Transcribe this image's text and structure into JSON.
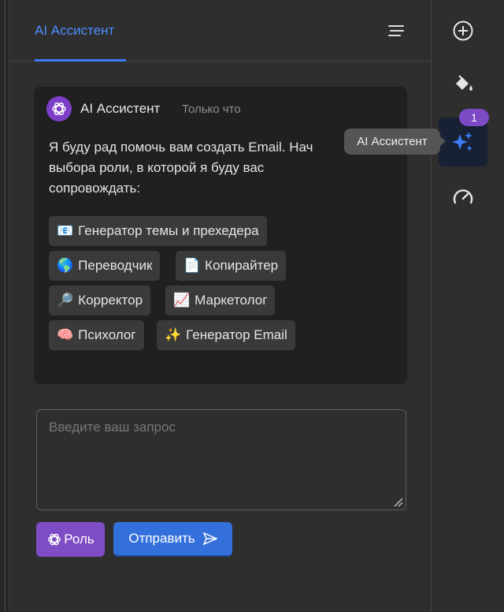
{
  "header": {
    "tab_label": "AI Ассистент"
  },
  "message": {
    "sender": "AI Ассистент",
    "time": "Только что",
    "text_line1": "Я буду рад помочь вам создать Email. Нач",
    "text_line2": "выбора роли, в которой я буду вас",
    "text_line3": "сопровождать:"
  },
  "roles": [
    {
      "emoji": "📧",
      "label": "Генератор темы и прехедера"
    },
    {
      "emoji": "🌎",
      "label": "Переводчик"
    },
    {
      "emoji": "📄",
      "label": "Копирайтер"
    },
    {
      "emoji": "🔎",
      "label": "Корректор"
    },
    {
      "emoji": "📈",
      "label": "Маркетолог"
    },
    {
      "emoji": "🧠",
      "label": "Психолог"
    },
    {
      "emoji": "✨",
      "label": "Генератор Email"
    }
  ],
  "input": {
    "placeholder": "Введите ваш запрос"
  },
  "buttons": {
    "role_label": "Роль",
    "send_label": "Отправить"
  },
  "sidebar": {
    "badge_count": "1",
    "tooltip": "AI Ассистент",
    "icons": [
      "plus-circle-icon",
      "paint-bucket-icon",
      "sparkles-icon",
      "speedometer-icon"
    ]
  },
  "colors": {
    "accent": "#3b7cf5",
    "role_button": "#7e4cc4",
    "send_button": "#3470dc",
    "badge": "#7c4ac4"
  }
}
